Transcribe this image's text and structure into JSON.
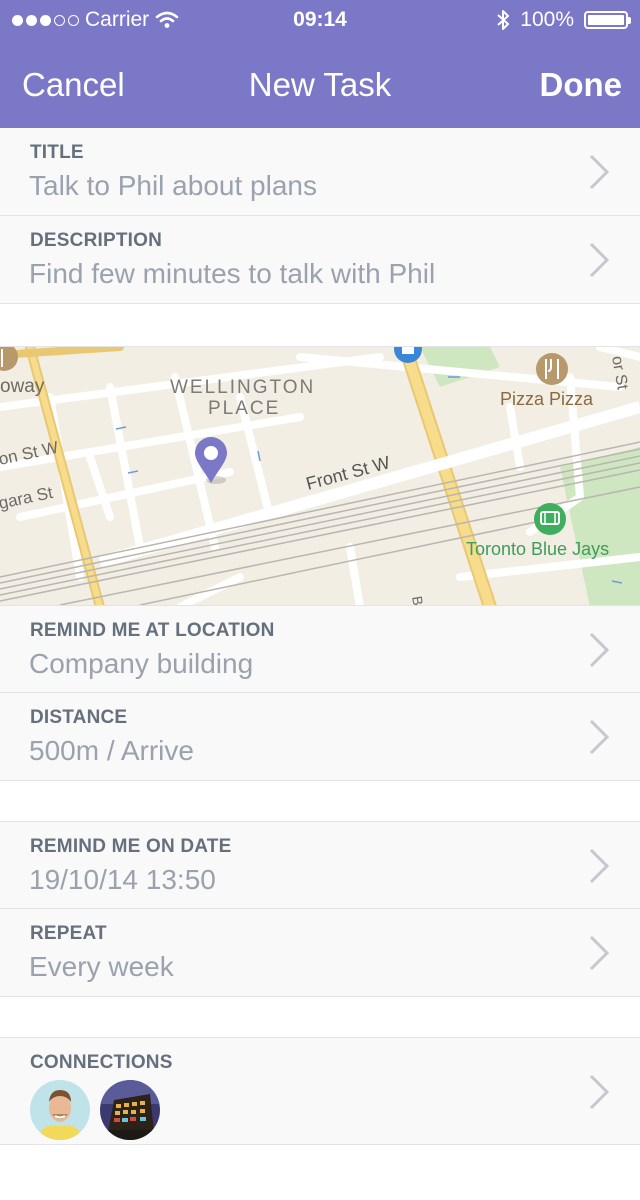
{
  "status_bar": {
    "carrier": "Carrier",
    "time": "09:14",
    "battery": "100%"
  },
  "nav": {
    "cancel": "Cancel",
    "title": "New Task",
    "done": "Done"
  },
  "fields": {
    "title": {
      "label": "TITLE",
      "value": "Talk to Phil about plans"
    },
    "description": {
      "label": "DESCRIPTION",
      "value": "Find few minutes to talk with Phil"
    },
    "remind_location": {
      "label": "REMIND ME AT LOCATION",
      "value": "Company building"
    },
    "distance": {
      "label": "DISTANCE",
      "value": "500m / Arrive"
    },
    "remind_date": {
      "label": "REMIND ME ON DATE",
      "value": "19/10/14 13:50"
    },
    "repeat": {
      "label": "REPEAT",
      "value": "Every week"
    },
    "connections": {
      "label": "CONNECTIONS"
    }
  },
  "map": {
    "labels": {
      "wellington1": "WELLINGTON",
      "wellington2": "PLACE",
      "front_st": "Front St W",
      "pizza": "Pizza Pizza",
      "blue_jays": "Toronto Blue Jays",
      "owway": "oway",
      "lon_st": "on St W",
      "agara_st": "gara St",
      "or_st": "or St",
      "b": "B"
    }
  },
  "colors": {
    "accent": "#7b78c8",
    "label": "#66707d",
    "value": "#9aa2ae"
  }
}
